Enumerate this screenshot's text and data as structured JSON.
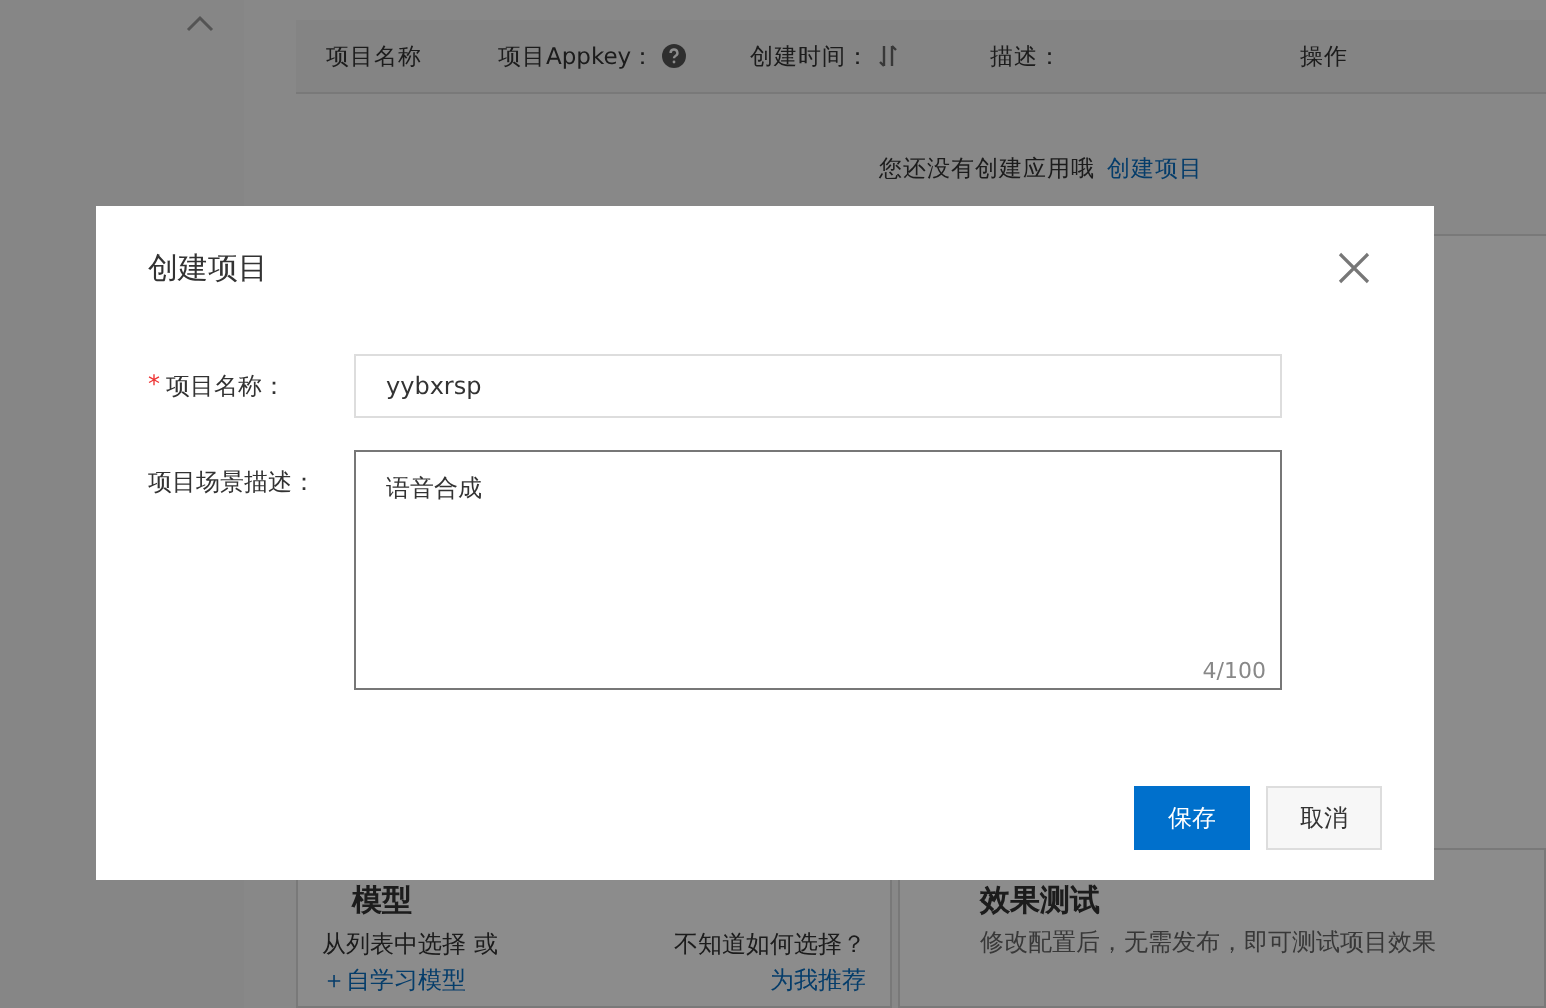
{
  "table": {
    "columns": [
      {
        "label": "项目名称"
      },
      {
        "label": "项目Appkey："
      },
      {
        "label": "创建时间："
      },
      {
        "label": "描述："
      },
      {
        "label": "操作"
      }
    ],
    "empty_message": "您还没有创建应用哦",
    "empty_link": "创建项目"
  },
  "cards": [
    {
      "title": "模型",
      "text": "从列表中选择 或",
      "link": "＋自学习模型",
      "hint": "不知道如何选择？",
      "hint_link": "为我推荐"
    },
    {
      "title": "效果测试",
      "text": "修改配置后，无需发布，即可测试项目效果"
    }
  ],
  "dialog": {
    "title": "创建项目",
    "fields": [
      {
        "kind": "input",
        "required": true,
        "required_mark": "*",
        "label": "项目名称：",
        "value": "yybxrsp"
      },
      {
        "kind": "textarea",
        "required": false,
        "label": "项目场景描述：",
        "value": "语音合成",
        "counter": "4/100"
      }
    ],
    "buttons": [
      {
        "label": "保存",
        "primary": true
      },
      {
        "label": "取消",
        "primary": false
      }
    ]
  }
}
